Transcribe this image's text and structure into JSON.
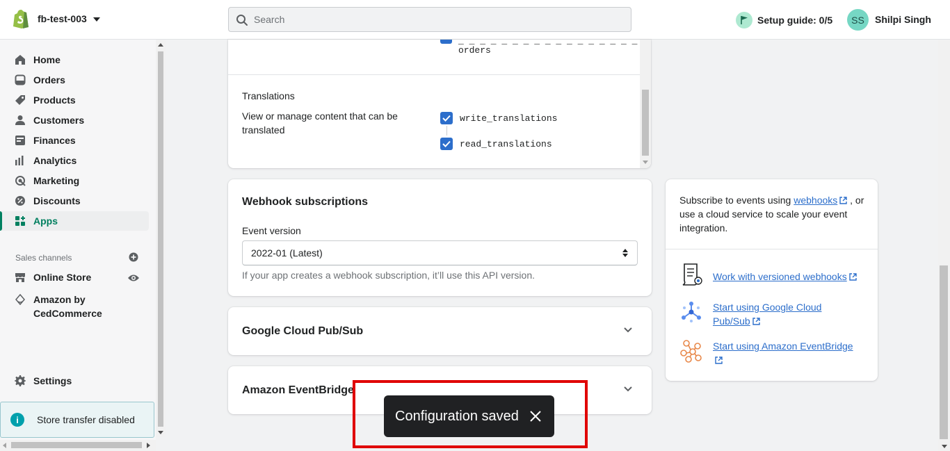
{
  "header": {
    "store_name": "fb-test-003",
    "search_placeholder": "Search",
    "setup_guide": "Setup guide: 0/5",
    "user_initials": "SS",
    "user_name": "Shilpi Singh"
  },
  "sidebar": {
    "items": [
      {
        "label": "Home",
        "icon": "home-icon"
      },
      {
        "label": "Orders",
        "icon": "orders-icon"
      },
      {
        "label": "Products",
        "icon": "tag-icon"
      },
      {
        "label": "Customers",
        "icon": "person-icon"
      },
      {
        "label": "Finances",
        "icon": "bank-icon"
      },
      {
        "label": "Analytics",
        "icon": "bar-chart-icon"
      },
      {
        "label": "Marketing",
        "icon": "target-icon"
      },
      {
        "label": "Discounts",
        "icon": "discount-icon"
      },
      {
        "label": "Apps",
        "icon": "apps-icon",
        "active": true
      }
    ],
    "sales_channels_title": "Sales channels",
    "online_store": "Online Store",
    "amazon": "Amazon by CedCommerce",
    "settings": "Settings",
    "store_transfer": "Store transfer disabled"
  },
  "scopes": {
    "top_line1": "_ _ _ _ _ _ _ _ _ _ _ _ _ _ _ _ _",
    "top_line2": "orders",
    "translations_title": "Translations",
    "translations_desc": "View or manage content that can be translated",
    "write_scope": "write_translations",
    "read_scope": "read_translations"
  },
  "webhooks": {
    "title": "Webhook subscriptions",
    "event_version_label": "Event version",
    "event_version_value": "2022-01 (Latest)",
    "help_text": "If your app creates a webhook subscription, it’ll use this API version."
  },
  "google_pubsub": {
    "title": "Google Cloud Pub/Sub"
  },
  "eventbridge": {
    "title": "Amazon EventBridge"
  },
  "side_card": {
    "intro_before": "Subscribe to events using ",
    "intro_link": "webhooks",
    "intro_after": " , or use a cloud service to scale your event integration.",
    "resources": [
      {
        "label": "Work with versioned webhooks",
        "icon": "document-icon"
      },
      {
        "label": "Start using Google Cloud Pub/Sub",
        "icon": "pubsub-icon"
      },
      {
        "label": "Start using Amazon EventBridge",
        "icon": "eventbridge-icon"
      }
    ]
  },
  "toast": {
    "message": "Configuration saved"
  },
  "colors": {
    "accent_green": "#008060",
    "link_blue": "#2c6ecb",
    "checkbox_blue": "#2c6ecb",
    "toast_bg": "#202123",
    "highlight_red": "#e00000"
  }
}
